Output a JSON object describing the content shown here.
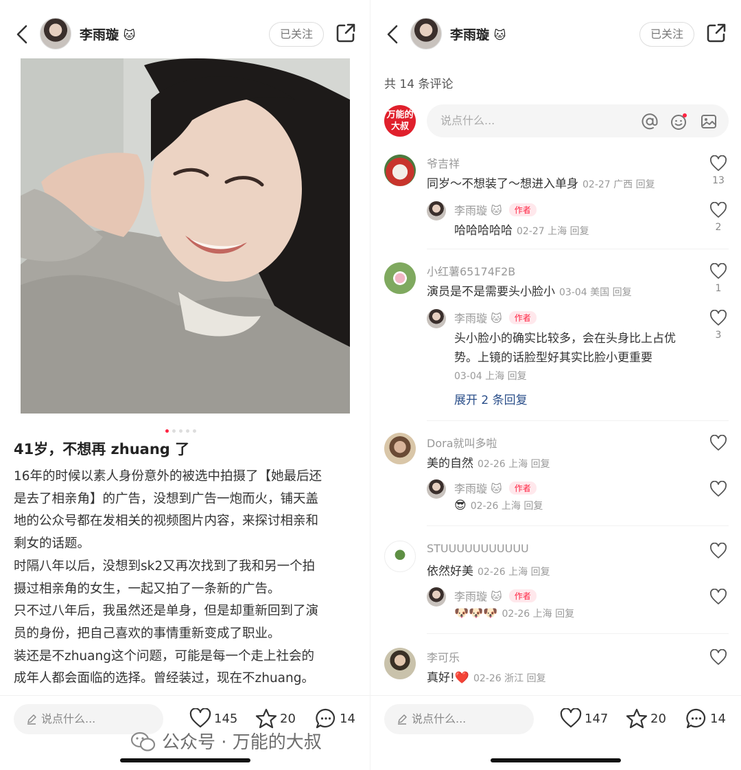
{
  "header": {
    "username": "李雨璇",
    "cat_emoji": "🐱",
    "follow_label": "已关注"
  },
  "post": {
    "title": "41岁，不想再 zhuang 了",
    "lines": [
      "16年的时候以素人身份意外的被选中拍摄了【她最后还",
      "是去了相亲角】的广告，没想到广告一炮而火，铺天盖",
      "地的公众号都在发相关的视频图片内容，来探讨相亲和",
      "剩女的话题。",
      "时隔八年以后，没想到sk2又再次找到了我和另一个拍",
      "摄过相亲角的女生，一起又拍了一条新的广告。",
      "只不过八年后，我虽然还是单身，但是却重新回到了演",
      "员的身份，把自己喜欢的事情重新变成了职业。",
      "装还是不zhuang这个问题，可能是每一个走上社会的",
      "成年人都会面临的选择。曾经装过，现在不zhuang。"
    ],
    "carousel_dots": 5,
    "carousel_active": 1
  },
  "left_bar": {
    "say_placeholder": "说点什么...",
    "likes": "145",
    "stars": "20",
    "comments": "14"
  },
  "comments_panel": {
    "count_label": "共 14 条评论",
    "my_avatar_text": "万能的大叔",
    "input_placeholder": "说点什么...",
    "author_tag": "作者",
    "threads": [
      {
        "user": "爷吉祥",
        "text": "同岁～不想装了～想进入单身",
        "meta": "02-27 广西 回复",
        "likes": "13",
        "reply": {
          "user": "李雨璇 🐱",
          "text": "哈哈哈哈哈",
          "meta": "02-27 上海 回复",
          "likes": "2"
        }
      },
      {
        "user": "小红薯65174F2B",
        "text": "演员是不是需要头小脸小",
        "meta": "03-04 美国 回复",
        "likes": "1",
        "reply": {
          "user": "李雨璇 🐱",
          "text_lines": [
            "头小脸小的确实比较多，会在头身比上占优",
            "势。上镜的话脸型好其实比脸小更重要"
          ],
          "meta": "03-04 上海 回复",
          "likes": "3"
        },
        "expand": "展开 2 条回复"
      },
      {
        "user": "Dora就叫多啦",
        "text": "美的自然",
        "meta": "02-26 上海 回复",
        "likes": "",
        "reply": {
          "user": "李雨璇 🐱",
          "text": "😎",
          "meta": "02-26 上海 回复",
          "likes": ""
        }
      },
      {
        "user": "STUUUUUUUUUUU",
        "text": "依然好美",
        "meta": "02-26 上海 回复",
        "likes": "",
        "reply": {
          "user": "李雨璇 🐱",
          "text": "🐶🐶🐶",
          "meta": "02-26 上海 回复",
          "likes": ""
        }
      },
      {
        "user": "李可乐",
        "text": "真好!❤️",
        "meta": "02-26 浙江 回复",
        "likes": ""
      }
    ]
  },
  "right_bar": {
    "say_placeholder": "说点什么...",
    "likes": "147",
    "stars": "20",
    "comments": "14"
  },
  "watermark": "公众号 · 万能的大叔",
  "colors": {
    "accent": "#ff2442",
    "link": "#2b4f8a"
  }
}
